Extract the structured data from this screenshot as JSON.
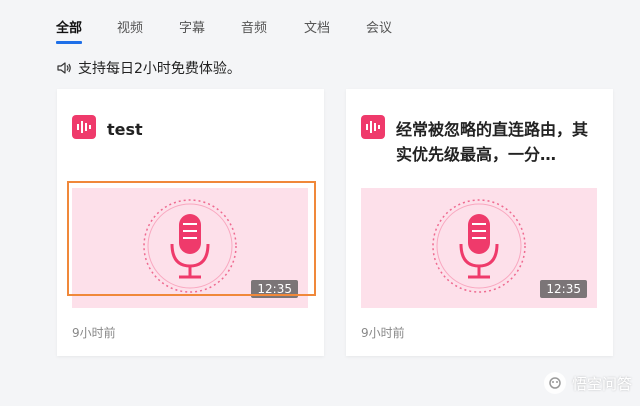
{
  "tabs": [
    {
      "label": "全部",
      "active": true
    },
    {
      "label": "视频",
      "active": false
    },
    {
      "label": "字幕",
      "active": false
    },
    {
      "label": "音频",
      "active": false
    },
    {
      "label": "文档",
      "active": false
    },
    {
      "label": "会议",
      "active": false
    }
  ],
  "notice": {
    "text": "支持每日2小时免费体验。",
    "icon": "speaker-icon"
  },
  "cards": [
    {
      "title": "test",
      "duration": "12:35",
      "time": "9小时前",
      "icon": "audio-wave-icon",
      "thumbnail_icon": "microphone-icon"
    },
    {
      "title": "经常被忽略的直连路由，其实优先级最高，一分…",
      "duration": "12:35",
      "time": "9小时前",
      "icon": "audio-wave-icon",
      "thumbnail_icon": "microphone-icon"
    }
  ],
  "watermark": {
    "text": "悟空问答"
  },
  "colors": {
    "accent": "#1e6fe8",
    "brand_pink": "#ef3a6b",
    "thumb_bg": "#fde0ea",
    "highlight": "#f0883a"
  }
}
